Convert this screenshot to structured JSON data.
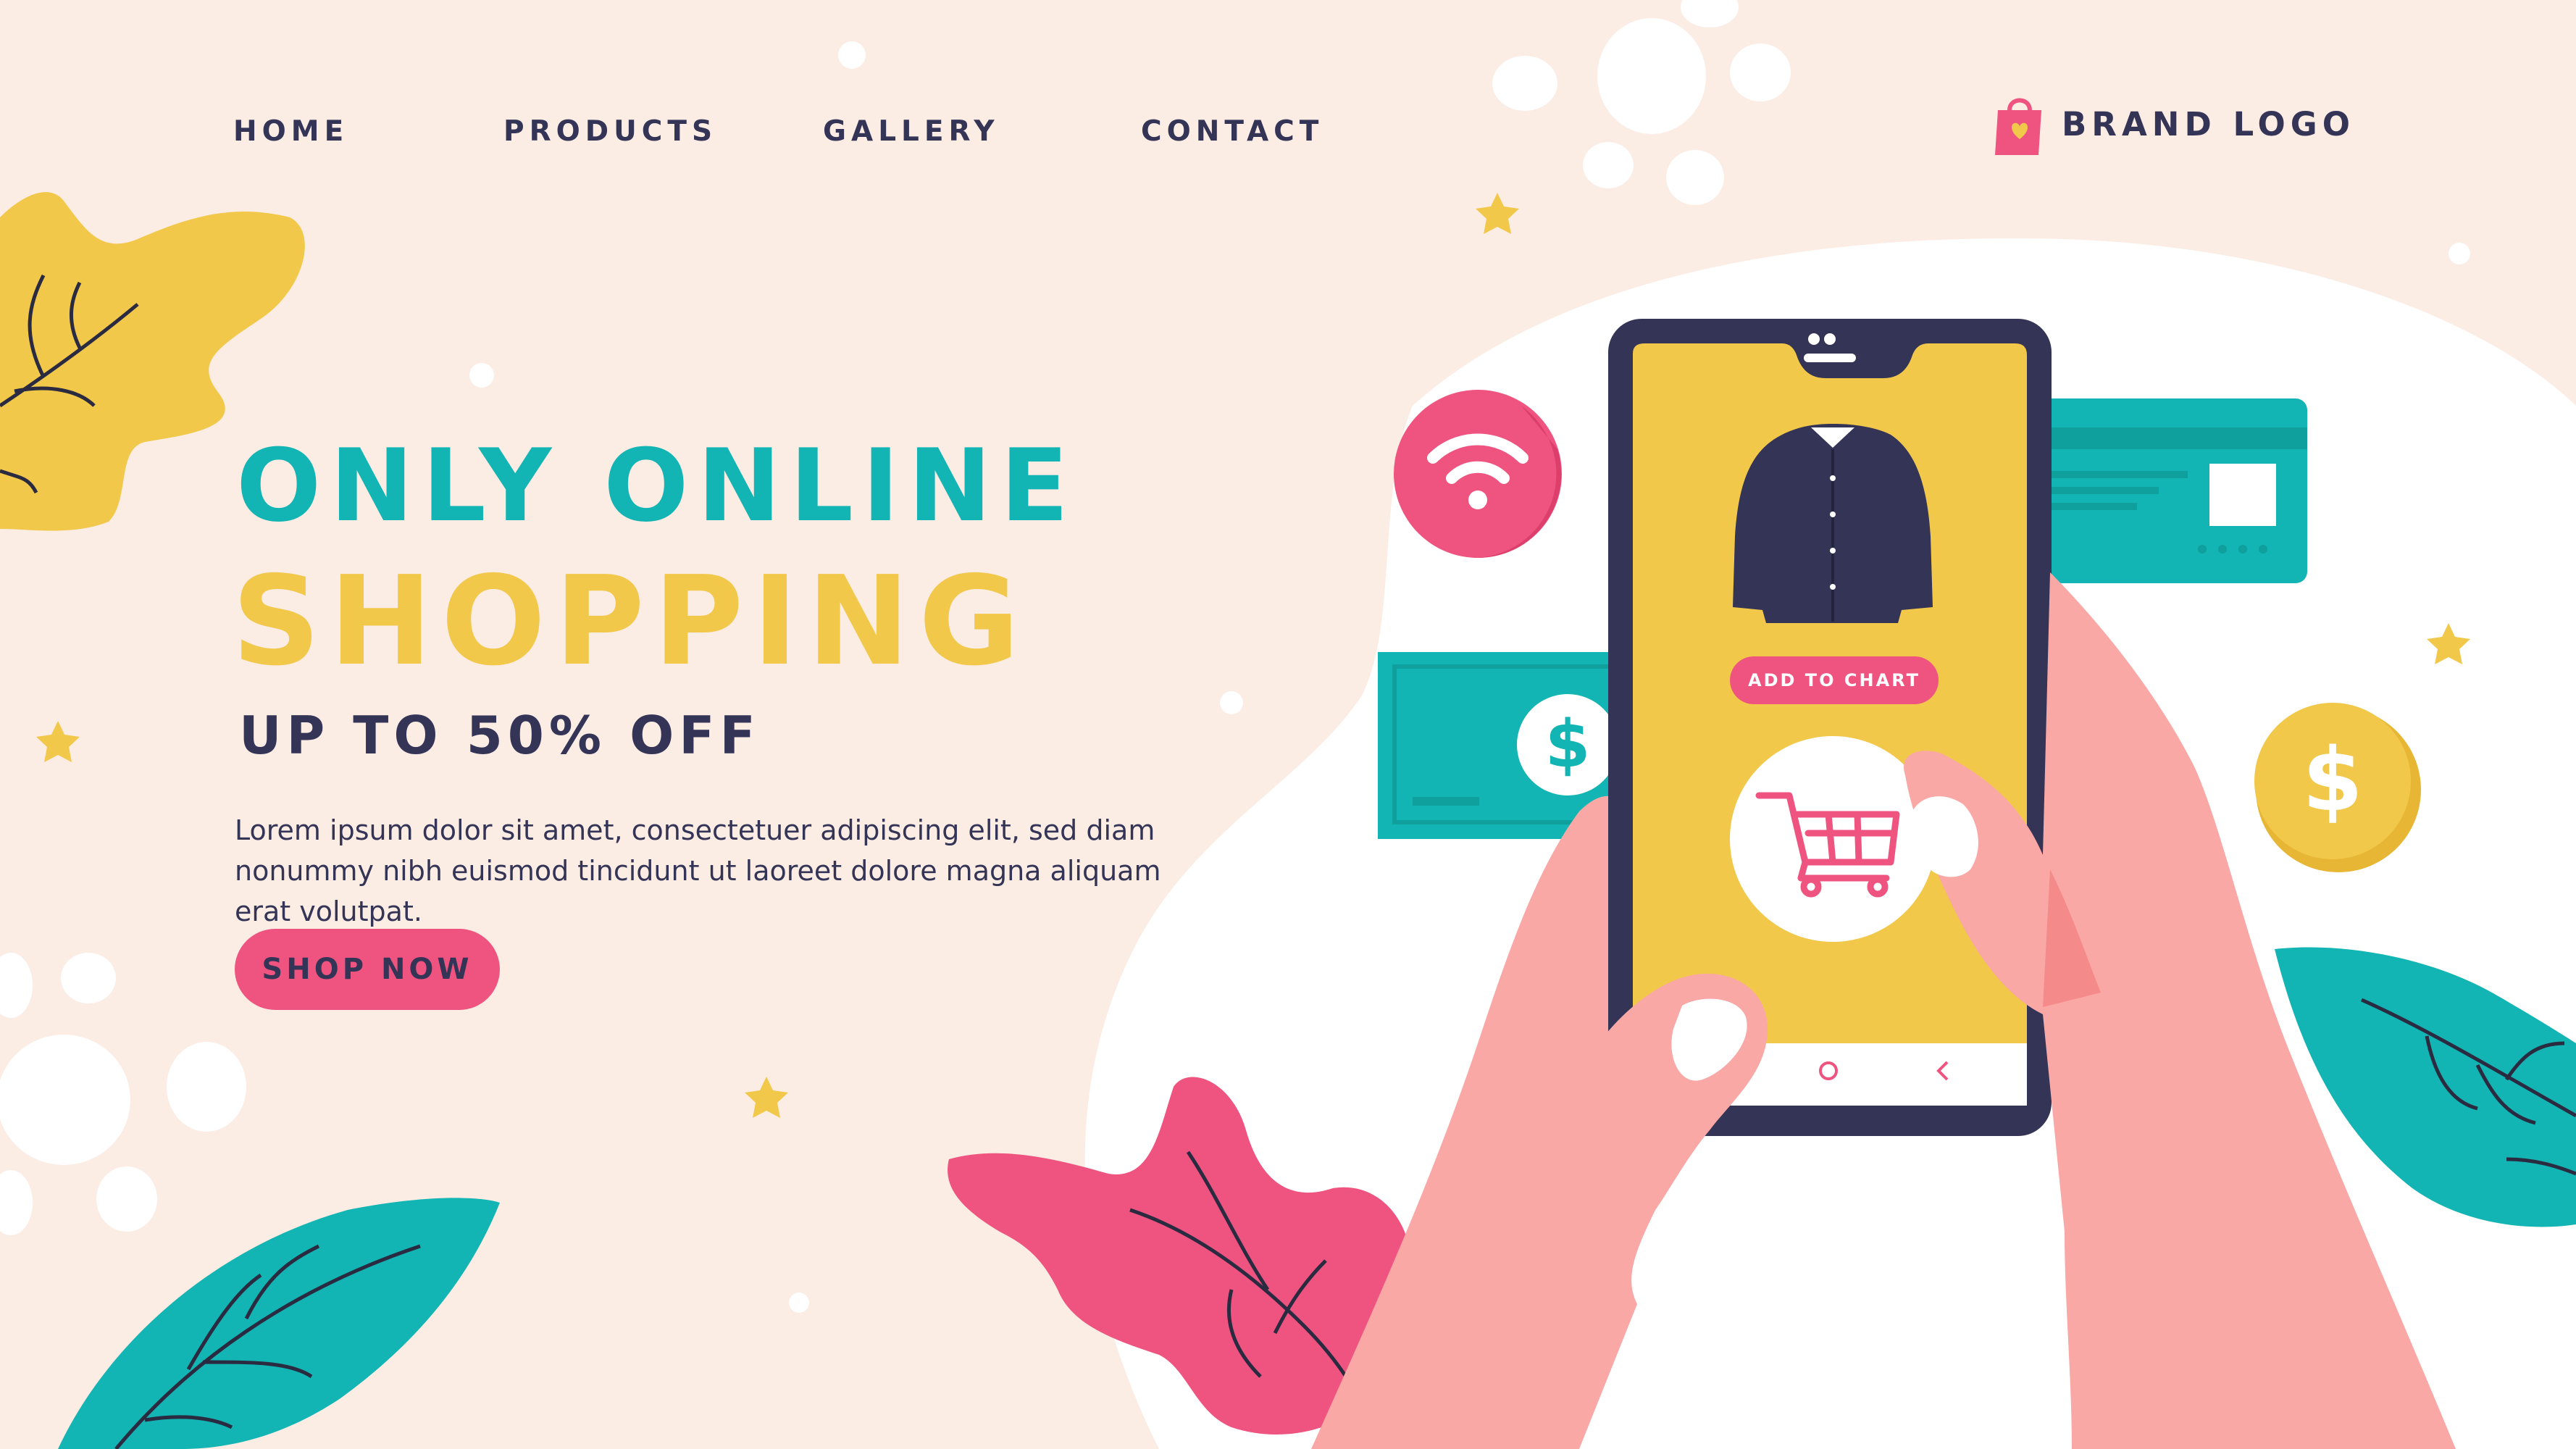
{
  "nav": {
    "items": [
      {
        "label": "HOME"
      },
      {
        "label": "PRODUCTS"
      },
      {
        "label": "GALLERY"
      },
      {
        "label": "CONTACT"
      }
    ]
  },
  "brand": {
    "logo_text": "BRAND LOGO",
    "icon": "shopping-bag-icon"
  },
  "hero": {
    "line1": "ONLY ONLINE",
    "line2": "SHOPPING",
    "line3": "UP TO 50% OFF",
    "body": "Lorem ipsum dolor sit amet, consectetuer adipiscing elit, sed diam nonummy nibh euismod tincidunt ut laoreet dolore magna aliquam erat volutpat.",
    "cta_label": "SHOP NOW"
  },
  "phone": {
    "product_icon": "shirt-icon",
    "add_button_label": "ADD TO CHART",
    "cart_icon": "shopping-cart-icon",
    "nav_icons": [
      "home-circle-icon",
      "back-arrow-icon"
    ]
  },
  "floating_icons": {
    "wifi": "wifi-icon",
    "dollar_note": "dollar-note-icon",
    "dollar_coin": "dollar-coin-icon",
    "credit_card": "credit-card-icon"
  },
  "colors": {
    "background": "#fbece4",
    "teal": "#12b5b3",
    "yellow": "#f2c84a",
    "navy": "#343456",
    "pink": "#ef5480",
    "skin": "#f9a8a6"
  }
}
